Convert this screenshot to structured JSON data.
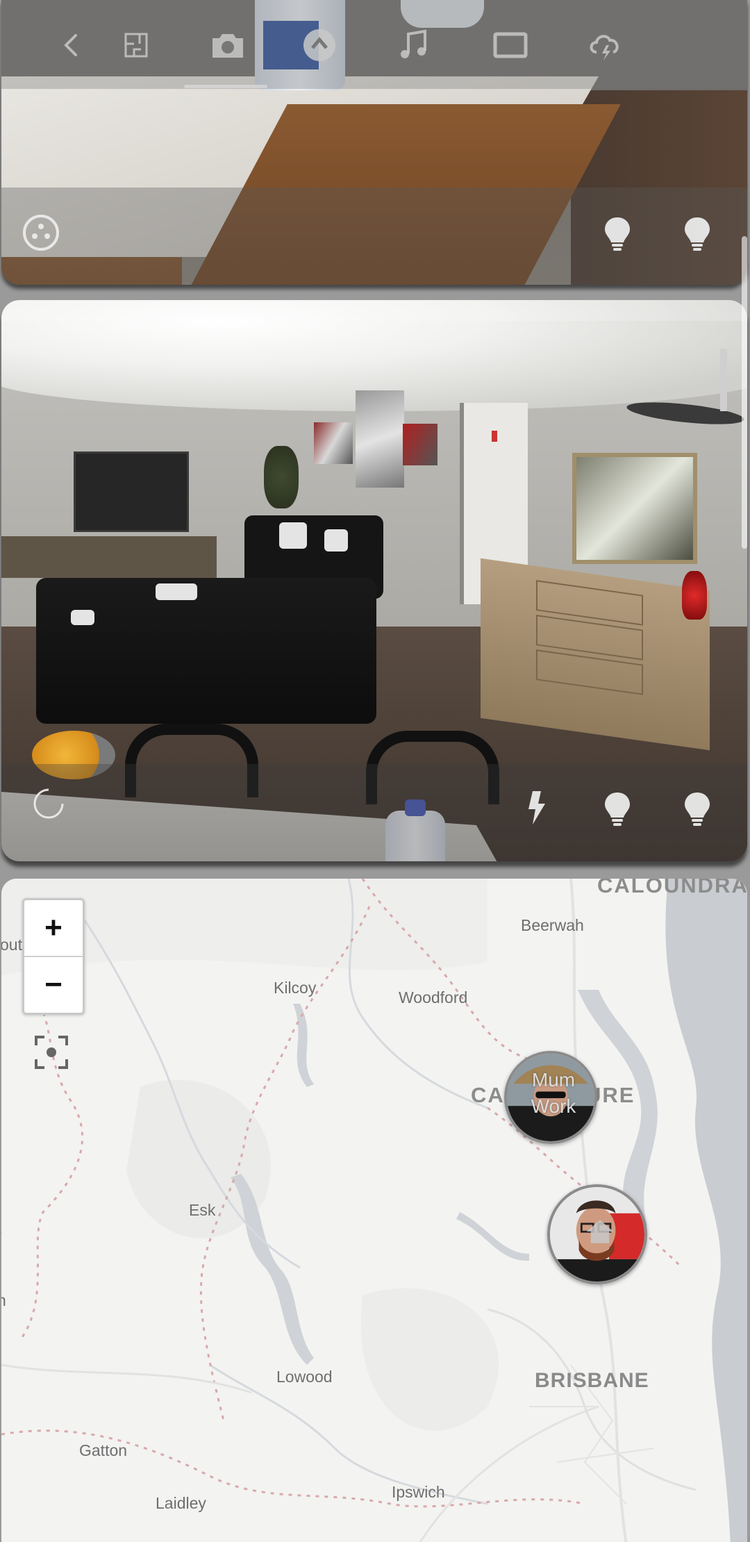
{
  "toolbar": {
    "items": [
      {
        "name": "back",
        "icon": "chevron-left-icon"
      },
      {
        "name": "floorplan",
        "icon": "floorplan-icon"
      },
      {
        "name": "camera",
        "icon": "camera-icon"
      },
      {
        "name": "alarm",
        "icon": "alarm-icon"
      },
      {
        "name": "music",
        "icon": "music-icon"
      },
      {
        "name": "screen",
        "icon": "screen-icon"
      },
      {
        "name": "weather",
        "icon": "cloud-lightning-icon"
      }
    ],
    "active_item": "alarm"
  },
  "camera_cards": [
    {
      "name": "kitchen-camera",
      "controls": [
        "ptz-icon",
        "bulb-icon",
        "bulb-icon"
      ]
    },
    {
      "name": "living-room-camera",
      "controls": [
        "loading-icon",
        "lightning-icon",
        "bulb-icon",
        "bulb-icon"
      ]
    }
  ],
  "map": {
    "zoom_in_label": "+",
    "zoom_out_label": "−",
    "labels": {
      "caloundra": "CALOUNDRA",
      "beerwah": "Beerwah",
      "kilcoy": "Kilcoy",
      "woodford": "Woodford",
      "caboolture": "CABOOLTURE",
      "esk": "Esk",
      "lowood": "Lowood",
      "brisbane": "BRISBANE",
      "gatton": "Gatton",
      "laidley": "Laidley",
      "ipswich": "Ipswich",
      "edge_left_1": "out",
      "edge_left_2": "t",
      "edge_left_3": "n"
    },
    "markers": [
      {
        "name": "person-marker-work",
        "label_line1": "Mum",
        "label_line2": "Work"
      },
      {
        "name": "person-marker-home",
        "icon": "home-icon"
      }
    ]
  },
  "colors": {
    "map_land": "#f3f3f2",
    "map_water": "#c9ccd0",
    "map_boundary": "#d8a9a9"
  }
}
